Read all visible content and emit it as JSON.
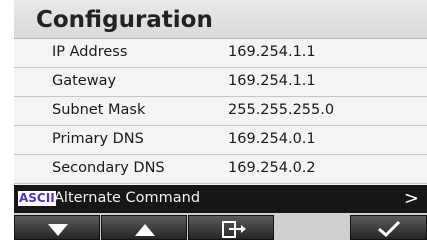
{
  "title": "Configuration",
  "rows": [
    {
      "label": "IP Address",
      "value": "169.254.1.1"
    },
    {
      "label": "Gateway",
      "value": "169.254.1.1"
    },
    {
      "label": "Subnet Mask",
      "value": "255.255.255.0"
    },
    {
      "label": "Primary DNS",
      "value": "169.254.0.1"
    },
    {
      "label": "Secondary DNS",
      "value": "169.254.0.2"
    }
  ],
  "command_bar": {
    "badge": "ASCII",
    "label": "Alternate Command",
    "chevron": ">"
  },
  "buttons": [
    {
      "name": "down-button",
      "icon": "arrow-down-icon"
    },
    {
      "name": "up-button",
      "icon": "arrow-up-icon"
    },
    {
      "name": "exit-button",
      "icon": "exit-icon"
    },
    {
      "name": "confirm-button",
      "icon": "checkmark-icon"
    }
  ],
  "colors": {
    "accent": "#5b2ad6",
    "command_bar": "#161616"
  }
}
